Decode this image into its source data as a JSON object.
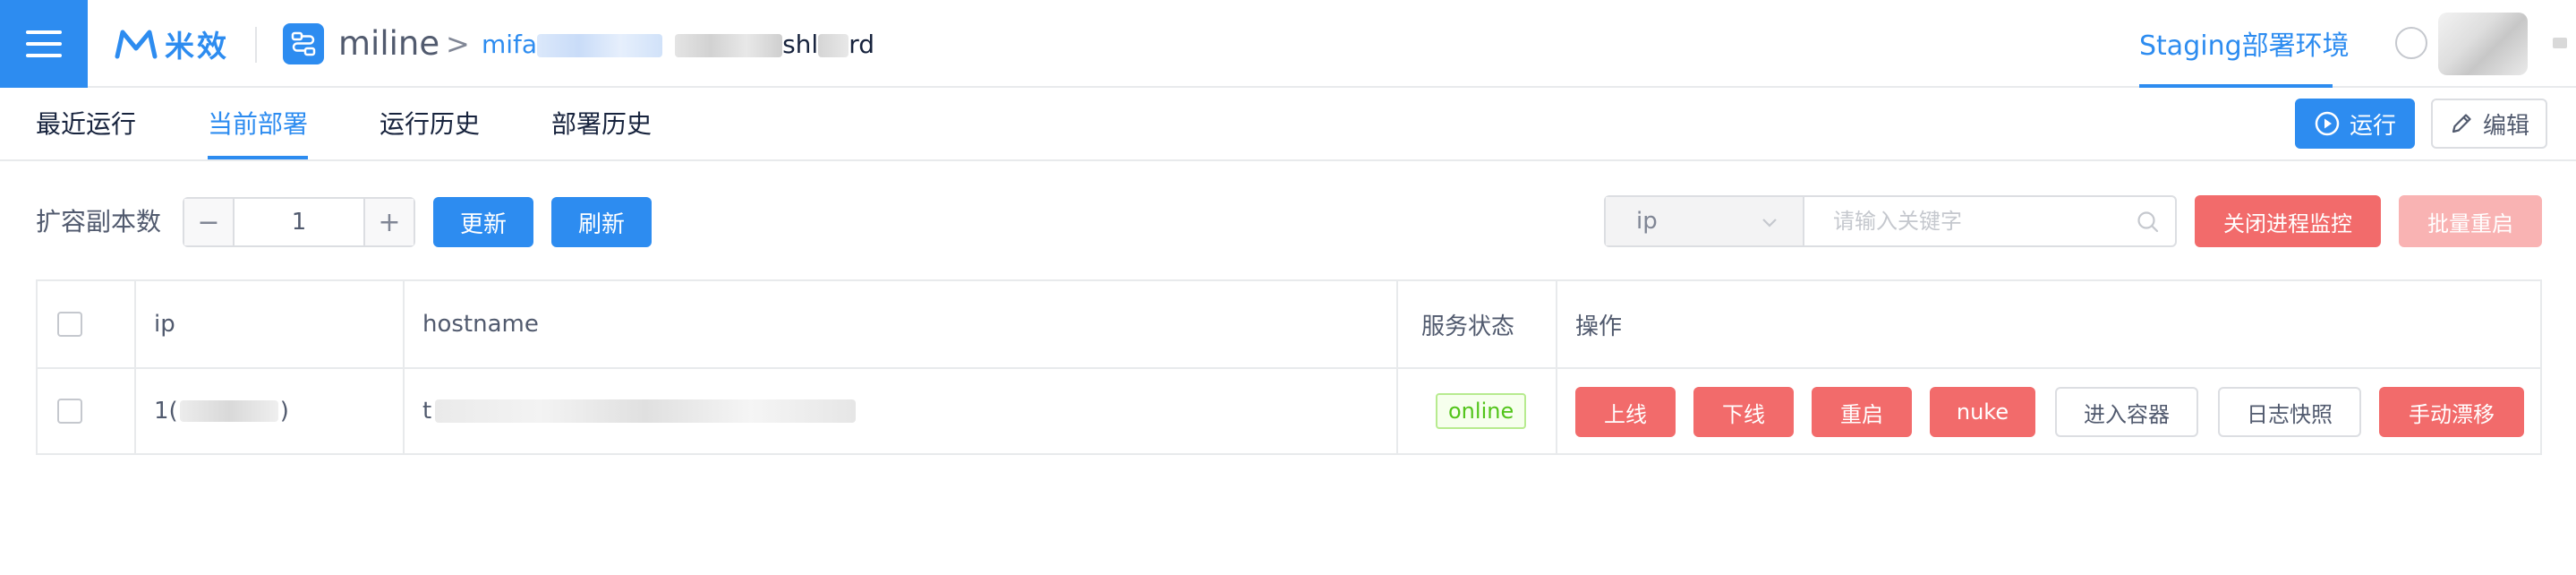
{
  "header": {
    "logo_text": "米效",
    "app_name": "miline",
    "breadcrumb_sep": ">",
    "breadcrumb_prefix": "mifa",
    "breadcrumb_suffix": "shl",
    "breadcrumb_tail": "rd",
    "env_tab": "Staging部署环境"
  },
  "subnav": {
    "tabs": [
      {
        "label": "最近运行",
        "active": false
      },
      {
        "label": "当前部署",
        "active": true
      },
      {
        "label": "运行历史",
        "active": false
      },
      {
        "label": "部署历史",
        "active": false
      }
    ],
    "run_label": "运行",
    "edit_label": "编辑"
  },
  "toolbar": {
    "scale_label": "扩容副本数",
    "replicas_value": "1",
    "minus": "−",
    "plus": "+",
    "update_label": "更新",
    "refresh_label": "刷新",
    "search_field": "ip",
    "search_placeholder": "请输入关键字",
    "close_monitor_label": "关闭进程监控",
    "batch_restart_label": "批量重启"
  },
  "table": {
    "columns": [
      "ip",
      "hostname",
      "服务状态",
      "操作"
    ],
    "rows": [
      {
        "ip_prefix": "1(",
        "ip_suffix": ")",
        "hostname_prefix": "t",
        "status": "online",
        "actions": [
          "上线",
          "下线",
          "重启",
          "nuke",
          "进入容器",
          "日志快照",
          "手动漂移"
        ]
      }
    ]
  },
  "colors": {
    "primary": "#2d8cf0",
    "danger": "#f26b6b",
    "danger_disabled": "#f9b3b3",
    "success": "#52c41a"
  }
}
